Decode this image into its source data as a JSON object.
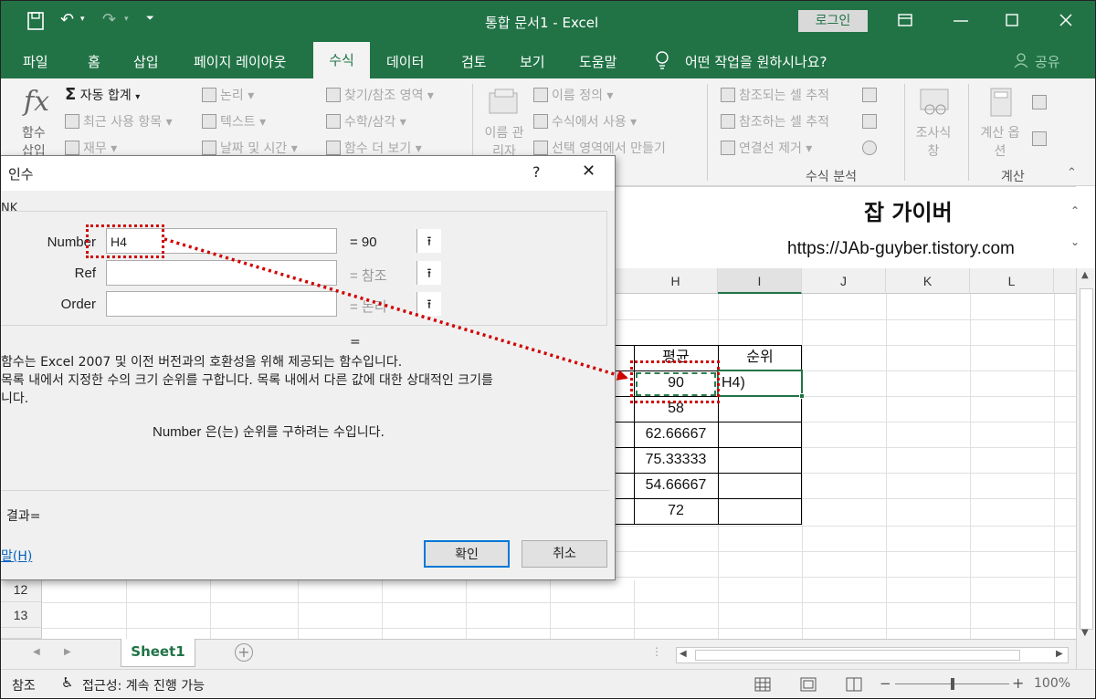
{
  "titlebar": {
    "title": "통합 문서1  -  Excel",
    "login": "로그인"
  },
  "tabs": [
    "파일",
    "홈",
    "삽입",
    "페이지 레이아웃",
    "수식",
    "데이터",
    "검토",
    "보기",
    "도움말"
  ],
  "active_tab": "수식",
  "tell_me": "어떤 작업을 원하시나요?",
  "share": "공유",
  "ribbon": {
    "insert_function": "함수 삽입",
    "autosum": "자동 합계",
    "recent": "최근 사용 항목",
    "financial": "재무",
    "logical": "논리",
    "text": "텍스트",
    "datetime": "날짜 및 시간",
    "lookup": "찾기/참조 영역",
    "math": "수학/삼각",
    "more": "함수 더 보기",
    "name_manager": "이름 관리자",
    "define_name": "이름 정의",
    "use_in_formula": "수식에서 사용",
    "create_from_sel": "선택 영역에서 만들기",
    "trace_precedents": "참조되는 셀 추적",
    "trace_dependents": "참조하는 셀 추적",
    "remove_arrows": "연결선 제거",
    "watch_window": "조사식 창",
    "calc_options": "계산 옵션",
    "group_audit": "수식 분석",
    "group_calc": "계산"
  },
  "watermark": {
    "name": "잡 가이버",
    "url": "https://JAb-guyber.tistory.com"
  },
  "columns": [
    "H",
    "I",
    "J",
    "K",
    "L"
  ],
  "rows_visible": [
    "12",
    "13"
  ],
  "table": {
    "header_avg": "평균",
    "header_rank": "순위",
    "values": [
      "90",
      "58",
      "62.66667",
      "75.33333",
      "54.66667",
      "72"
    ],
    "editing": "H4)"
  },
  "dialog": {
    "title": "인수",
    "help": "?",
    "close": "✕",
    "group": "NK",
    "labels": [
      "Number",
      "Ref",
      "Order"
    ],
    "number_value": "H4",
    "results": [
      "= 90",
      "= 참조",
      "= 논리"
    ],
    "eq_total": "=",
    "desc1": "함수는 Excel 2007 및 이전 버전과의 호환성을 위해 제공되는 함수입니다.",
    "desc2": "목록 내에서 지정한 수의 크기 순위를 구합니다. 목록 내에서 다른 값에 대한 상대적인 크기를",
    "desc3": "니다.",
    "arg_desc_label": "Number",
    "arg_desc": "은(는) 순위를 구하려는 수입니다.",
    "result": "결과=",
    "help_link": "말(H)",
    "ok": "확인",
    "cancel": "취소"
  },
  "sheet": {
    "tab": "Sheet1",
    "add": "+"
  },
  "status": {
    "mode": "참조",
    "access": "접근성: 계속 진행 가능",
    "zoom": "100%"
  },
  "colors": {
    "excel_green": "#217346",
    "ribbon_bg": "#f3f3f3",
    "highlight_red": "#d00000",
    "marquee_green": "#2e7d4f"
  }
}
